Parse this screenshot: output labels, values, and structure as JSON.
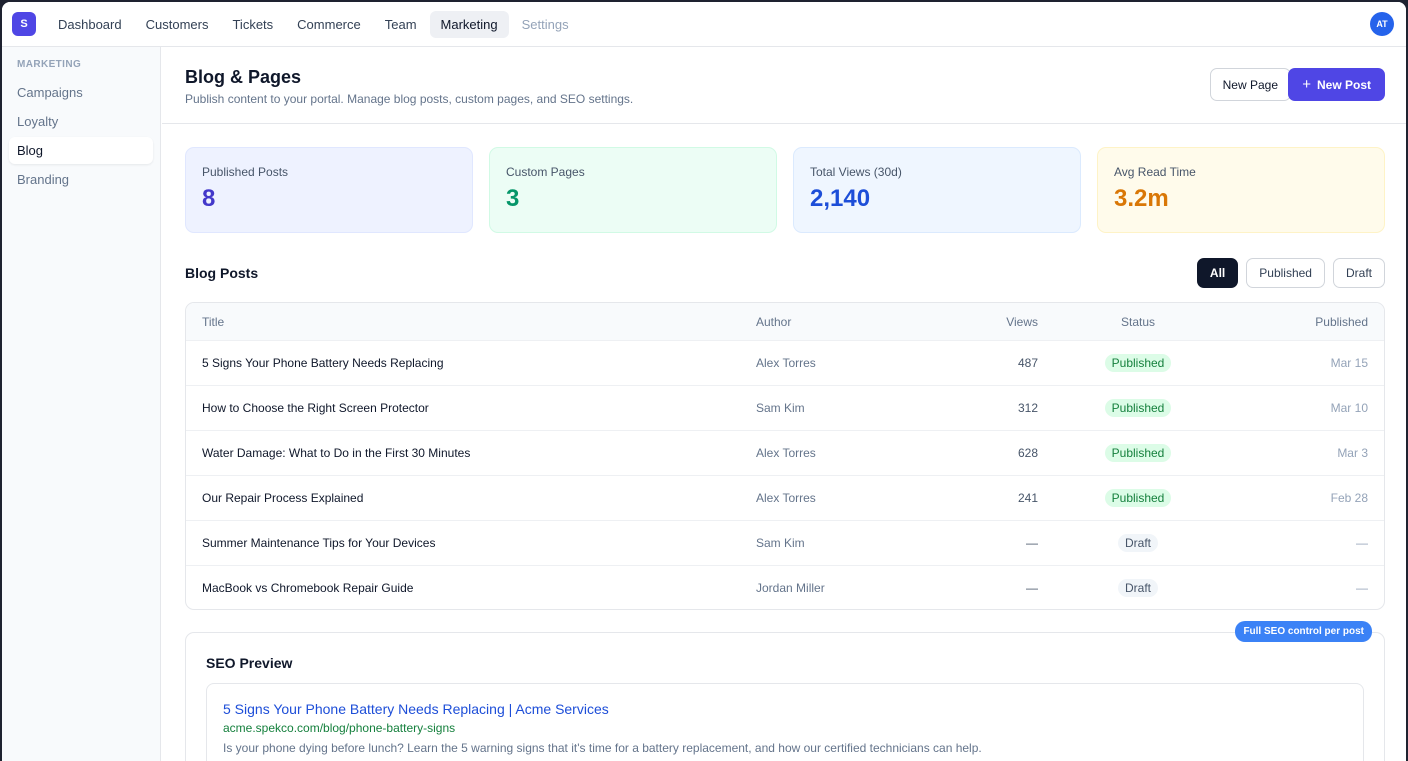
{
  "app": {
    "logo_letter": "S",
    "avatar_initials": "AT"
  },
  "nav": {
    "items": [
      {
        "label": "Dashboard"
      },
      {
        "label": "Customers"
      },
      {
        "label": "Tickets"
      },
      {
        "label": "Commerce"
      },
      {
        "label": "Team"
      },
      {
        "label": "Marketing"
      },
      {
        "label": "Settings"
      }
    ],
    "active": "Marketing"
  },
  "sidebar": {
    "heading": "MARKETING",
    "items": [
      {
        "label": "Campaigns"
      },
      {
        "label": "Loyalty"
      },
      {
        "label": "Blog"
      },
      {
        "label": "Branding"
      }
    ],
    "active": "Blog"
  },
  "header": {
    "title": "Blog & Pages",
    "subtitle": "Publish content to your portal. Manage blog posts, custom pages, and SEO settings.",
    "new_page_label": "New Page",
    "new_post_label": "New Post"
  },
  "stats": [
    {
      "label": "Published Posts",
      "value": "8"
    },
    {
      "label": "Custom Pages",
      "value": "3"
    },
    {
      "label": "Total Views (30d)",
      "value": "2,140"
    },
    {
      "label": "Avg Read Time",
      "value": "3.2m"
    }
  ],
  "blog_posts": {
    "title": "Blog Posts",
    "filters": [
      {
        "label": "All"
      },
      {
        "label": "Published"
      },
      {
        "label": "Draft"
      }
    ],
    "active_filter": "All",
    "columns": {
      "title": "Title",
      "author": "Author",
      "views": "Views",
      "status": "Status",
      "published": "Published"
    },
    "rows": [
      {
        "title": "5 Signs Your Phone Battery Needs Replacing",
        "author": "Alex Torres",
        "views": "487",
        "status": "Published",
        "published": "Mar 15"
      },
      {
        "title": "How to Choose the Right Screen Protector",
        "author": "Sam Kim",
        "views": "312",
        "status": "Published",
        "published": "Mar 10"
      },
      {
        "title": "Water Damage: What to Do in the First 30 Minutes",
        "author": "Alex Torres",
        "views": "628",
        "status": "Published",
        "published": "Mar 3"
      },
      {
        "title": "Our Repair Process Explained",
        "author": "Alex Torres",
        "views": "241",
        "status": "Published",
        "published": "Feb 28"
      },
      {
        "title": "Summer Maintenance Tips for Your Devices",
        "author": "Sam Kim",
        "views": "—",
        "status": "Draft",
        "published": "—"
      },
      {
        "title": "MacBook vs Chromebook Repair Guide",
        "author": "Jordan Miller",
        "views": "—",
        "status": "Draft",
        "published": "—"
      }
    ]
  },
  "seo": {
    "title": "SEO Preview",
    "pill": "Full SEO control per post",
    "preview_title": "5 Signs Your Phone Battery Needs Replacing | Acme Services",
    "preview_url": "acme.spekco.com/blog/phone-battery-signs",
    "preview_description": "Is your phone dying before lunch? Learn the 5 warning signs that it's time for a battery replacement, and how our certified technicians can help."
  },
  "colors": {
    "primary": "#4f46e5",
    "published_badge": "#dcfce7",
    "draft_badge": "#f1f5f9"
  }
}
